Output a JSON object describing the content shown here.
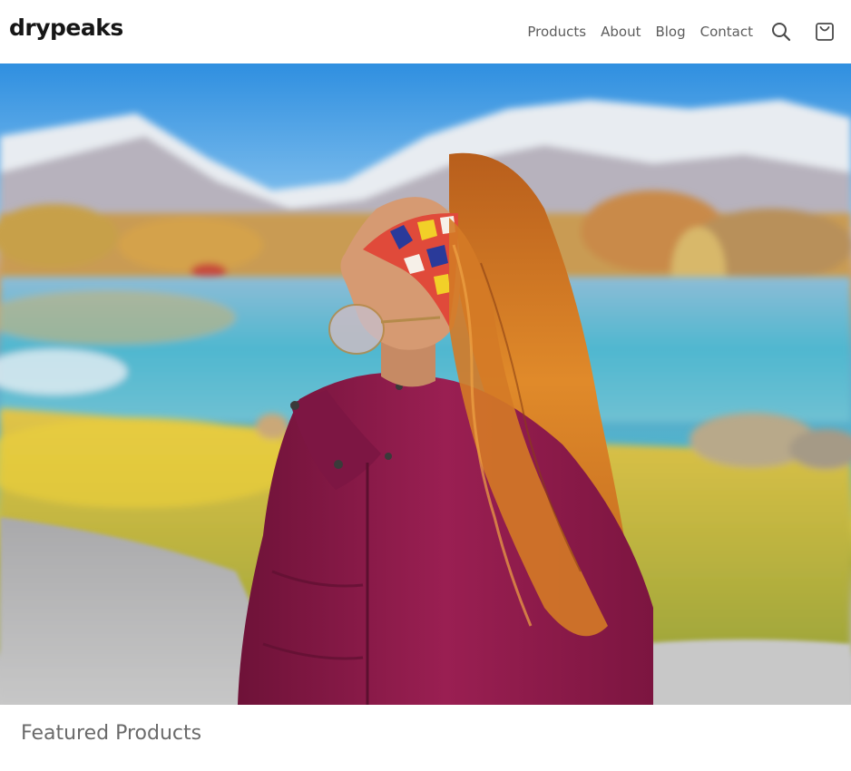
{
  "header": {
    "logo_text": "drypeaks",
    "nav": {
      "products": "Products",
      "about": "About",
      "blog": "Blog",
      "contact": "Contact"
    },
    "icons": {
      "search": "search-icon",
      "cart": "shopping-bag-icon"
    }
  },
  "hero": {
    "image": "hero-image"
  },
  "featured": {
    "title": "Featured Products"
  },
  "colors": {
    "text_dark": "#161616",
    "nav_text": "#5c5c5c",
    "heading_text": "#6a6a6a",
    "jacket": "#8a1a48"
  }
}
